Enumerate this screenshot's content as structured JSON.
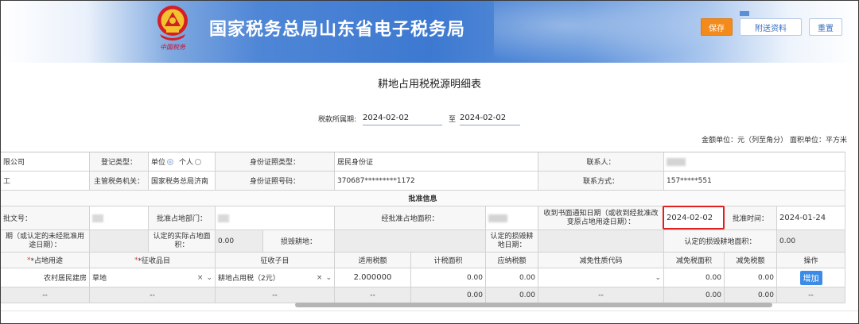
{
  "header": {
    "site_title": "国家税务总局山东省电子税务局",
    "emblem_text": "中国税务",
    "save_label": "保存",
    "attach_label": "附送资料",
    "reset_label": "重置"
  },
  "page": {
    "title": "耕地占用税税源明细表",
    "period_label": "税款所属期:",
    "period_from": "2024-02-02",
    "period_to_label": "至",
    "period_to": "2024-02-02",
    "units": "金额单位：元（列至角分）   面积单位：平方米"
  },
  "form": {
    "r1": {
      "company_tail": "限公司",
      "reg_type_label": "登记类型：",
      "reg_type_opt1": "单位",
      "reg_type_opt2": "个人",
      "id_type_label": "身份证照类型：",
      "id_type_value": "居民身份证",
      "contact_label": "联系人："
    },
    "r2": {
      "left_tail": "工",
      "tax_office_label": "主管税务机关：",
      "tax_office_value": "国家税务总局济南",
      "id_no_label": "身份证照号码：",
      "id_no_value": "370687*********1172",
      "phone_label": "联系方式：",
      "phone_value": "157*****551"
    },
    "approval_header": "批准信息",
    "r4": {
      "doc_no_label": "批文号：",
      "approve_dept_label": "批准占地部门：",
      "approved_area_label": "经批准占地面积：",
      "notice_date_label": "收到书面通知日期（或收到经批准改变原占地用途日期）：",
      "notice_date_value": "2024-02-02",
      "approve_time_label": "批准时间：",
      "approve_time_value": "2024-01-24"
    },
    "r5": {
      "unapproved_label": "期（或认定的未经批准用途日期）：",
      "actual_area_label": "认定的实际占地面积：",
      "actual_area_value": "0.00",
      "damage_land_label": "损毁耕地：",
      "damage_date_label": "认定的损毁耕地日期：",
      "damage_area_label": "认定的损毁耕地面积：",
      "damage_area_value": "0.00"
    },
    "columns": {
      "land_use": "*占地用途",
      "levy_item": "*征收品目",
      "levy_subitem": "征收子目",
      "rate": "适用税额",
      "area": "计税面积",
      "tax_payable": "应纳税额",
      "relief_code": "减免性质代码",
      "relief_area": "减免税面积",
      "relief_tax": "减免税额",
      "op": "操作"
    },
    "row1": {
      "land_use": "农村居民建房",
      "levy_item": "草地",
      "levy_subitem": "耕地占用税（2元）",
      "rate": "2.000000",
      "area": "0.00",
      "tax_payable": "0.00",
      "relief_code": "",
      "relief_area": "0.00",
      "relief_tax": "0.00",
      "op_label": "增加"
    },
    "row2": {
      "land_use": "--",
      "levy_item": "--",
      "levy_subitem": "--",
      "rate": "--",
      "area": "0.00",
      "tax_payable": "0.00",
      "relief_code": "--",
      "relief_area": "0.00",
      "relief_tax": "0.00",
      "op": "--"
    },
    "controls": {
      "clear": "×",
      "caret": "⌄"
    }
  },
  "colors": {
    "accent": "#3c8ce7",
    "save": "#f38b1c",
    "highlight": "#e02020"
  }
}
